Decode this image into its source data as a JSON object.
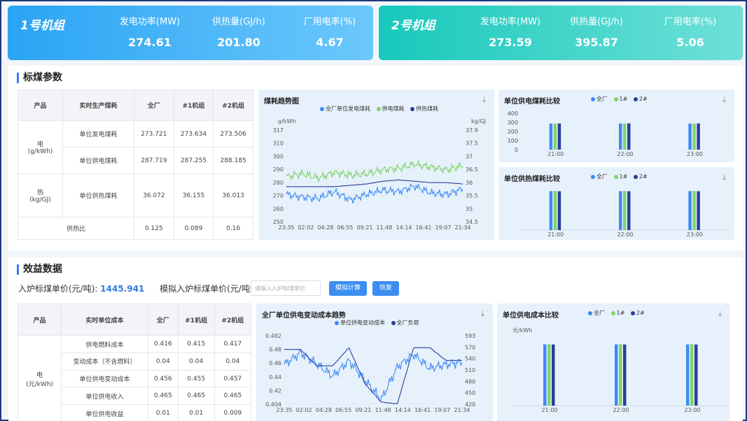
{
  "unit1": {
    "name": "1号机组",
    "m1_label": "发电功率(MW)",
    "m1_value": "274.61",
    "m2_label": "供热量(GJ/h)",
    "m2_value": "201.80",
    "m3_label": "厂用电率(%)",
    "m3_value": "4.67"
  },
  "unit2": {
    "name": "2号机组",
    "m1_label": "发电功率(MW)",
    "m1_value": "273.59",
    "m2_label": "供热量(GJ/h)",
    "m2_value": "395.87",
    "m3_label": "厂用电率(%)",
    "m3_value": "5.06"
  },
  "coal": {
    "title": "标煤参数",
    "headers": [
      "产品",
      "实时生产煤耗",
      "全厂",
      "#1机组",
      "#2机组"
    ],
    "elec_label": "电",
    "elec_unit": "(g/kWh)",
    "rows": [
      {
        "label": "单位发电煤耗",
        "v": [
          "273.721",
          "273.634",
          "273.506"
        ]
      },
      {
        "label": "单位供电煤耗",
        "v": [
          "287.719",
          "287.255",
          "288.185"
        ]
      }
    ],
    "heat_label": "热",
    "heat_unit": "(kg/GJ)",
    "heat_row": {
      "label": "单位供热煤耗",
      "v": [
        "36.072",
        "36.155",
        "36.013"
      ]
    },
    "ratio_row": {
      "label": "供热比",
      "v": [
        "0.125",
        "0.089",
        "0.16"
      ]
    }
  },
  "trend1": {
    "title": "煤耗趋势图",
    "legend": [
      "全厂单位发电煤耗",
      "供电煤耗",
      "供热煤耗"
    ],
    "left_unit": "g/kWh",
    "right_unit": "kg/GJ"
  },
  "cmp1": {
    "title": "单位供电煤耗比较",
    "legend": [
      "全厂",
      "1#",
      "2#"
    ]
  },
  "cmp2": {
    "title": "单位供热煤耗比较",
    "legend": [
      "全厂",
      "1#",
      "2#"
    ]
  },
  "benefit": {
    "title": "效益数据",
    "price_label": "入炉标煤单价(元/吨):",
    "price_value": "1445.941",
    "sim_label": "模拟入炉标煤单价(元/吨煤价):",
    "input_placeholder": "请输入入炉标煤单价",
    "btn_calc": "模拟计算",
    "btn_reset": "恢复",
    "headers": [
      "产品",
      "实时单位成本",
      "全厂",
      "#1机组",
      "#2机组"
    ],
    "elec_label": "电",
    "elec_unit": "(元/kWh)",
    "rows": [
      {
        "label": "供电燃料成本",
        "v": [
          "0.416",
          "0.415",
          "0.417"
        ]
      },
      {
        "label": "变动成本（不含燃料）",
        "v": [
          "0.04",
          "0.04",
          "0.04"
        ]
      },
      {
        "label": "单位供电变动成本",
        "v": [
          "0.456",
          "0.455",
          "0.457"
        ]
      },
      {
        "label": "单位供电收入",
        "v": [
          "0.465",
          "0.465",
          "0.465"
        ]
      },
      {
        "label": "单位供电收益",
        "v": [
          "0.01",
          "0.01",
          "0.009"
        ]
      }
    ]
  },
  "trend2": {
    "title": "全厂单位供电变动成本趋势",
    "legend": [
      "单位供电变动成本",
      "全厂负荷"
    ]
  },
  "cmp3": {
    "title": "单位供电成本比较",
    "legend": [
      "全厂",
      "1#",
      "2#"
    ],
    "unit": "元/kWh"
  },
  "colors": {
    "series_blue": "#3d8af7",
    "series_green": "#7fd46a",
    "series_navy": "#2b3e9c",
    "accent": "#3a7df0"
  },
  "chart_data": [
    {
      "type": "line",
      "title": "煤耗趋势图",
      "x_ticks": [
        "23:35",
        "02:02",
        "04:28",
        "06:55",
        "09:21",
        "11:48",
        "14:14",
        "16:41",
        "19:07",
        "21:34"
      ],
      "ylim_left": [
        250,
        317
      ],
      "ylim_right": [
        34.5,
        37.9
      ],
      "y_ticks_left": [
        317,
        310,
        300,
        290,
        280,
        270,
        260,
        250
      ],
      "y_ticks_right": [
        37.9,
        37.5,
        37,
        36.5,
        36,
        35.5,
        35,
        34.5
      ],
      "series": [
        {
          "name": "全厂单位发电煤耗",
          "values": [
            270,
            268,
            267,
            272,
            266,
            270,
            273,
            272,
            276,
            271,
            270,
            274
          ]
        },
        {
          "name": "供电煤耗",
          "values": [
            283,
            285,
            282,
            286,
            284,
            285,
            288,
            289,
            292,
            290,
            288,
            291
          ]
        },
        {
          "name": "供热煤耗",
          "values": [
            35.8,
            35.8,
            35.8,
            35.8,
            35.85,
            35.9,
            36.0,
            36.05,
            36.0,
            35.95,
            35.95,
            35.9
          ]
        }
      ]
    },
    {
      "type": "bar",
      "title": "单位供电煤耗比较",
      "categories": [
        "21:00",
        "22:00",
        "23:00"
      ],
      "ylim": [
        0,
        300
      ],
      "y_ticks": [
        0,
        100,
        200,
        300,
        400
      ],
      "series": [
        {
          "name": "全厂",
          "values": [
            287,
            288,
            287
          ]
        },
        {
          "name": "1#",
          "values": [
            287,
            288,
            287
          ]
        },
        {
          "name": "2#",
          "values": [
            288,
            289,
            288
          ]
        }
      ]
    },
    {
      "type": "bar",
      "title": "单位供热煤耗比较",
      "categories": [
        "21:00",
        "22:00",
        "23:00"
      ],
      "series": [
        {
          "name": "全厂",
          "values": [
            36.1,
            36.1,
            36.1
          ]
        },
        {
          "name": "1#",
          "values": [
            36.2,
            36.2,
            36.2
          ]
        },
        {
          "name": "2#",
          "values": [
            36.0,
            36.0,
            36.0
          ]
        }
      ]
    },
    {
      "type": "line",
      "title": "全厂单位供电变动成本趋势",
      "x_ticks": [
        "23:35",
        "02:02",
        "04:28",
        "06:55",
        "09:21",
        "11:48",
        "14:14",
        "16:41",
        "19:07",
        "21:34"
      ],
      "ylim_left": [
        0.404,
        0.492
      ],
      "ylim_right": [
        404,
        593
      ],
      "y_ticks_left": [
        0.492,
        0.48,
        0.46,
        0.44,
        0.42,
        0.404
      ],
      "y_ticks_right": [
        593,
        570,
        540,
        510,
        480,
        450,
        420
      ],
      "series": [
        {
          "name": "单位供电变动成本",
          "values": [
            0.455,
            0.47,
            0.456,
            0.44,
            0.46,
            0.435,
            0.41,
            0.452,
            0.468,
            0.45,
            0.455,
            0.458
          ]
        },
        {
          "name": "全厂负荷",
          "values": [
            555,
            555,
            510,
            510,
            560,
            460,
            410,
            405,
            560,
            560,
            525,
            525
          ]
        }
      ]
    },
    {
      "type": "bar",
      "title": "单位供电成本比较",
      "categories": [
        "21:00",
        "22:00",
        "23:00"
      ],
      "y_ticks": [
        0,
        0.1,
        0.2,
        0.3,
        0.4,
        0.5
      ],
      "ylabel": "元/kWh",
      "series": [
        {
          "name": "全厂",
          "values": [
            0.456,
            0.456,
            0.456
          ]
        },
        {
          "name": "1#",
          "values": [
            0.457,
            0.457,
            0.457
          ]
        },
        {
          "name": "2#",
          "values": [
            0.455,
            0.455,
            0.455
          ]
        }
      ]
    }
  ]
}
